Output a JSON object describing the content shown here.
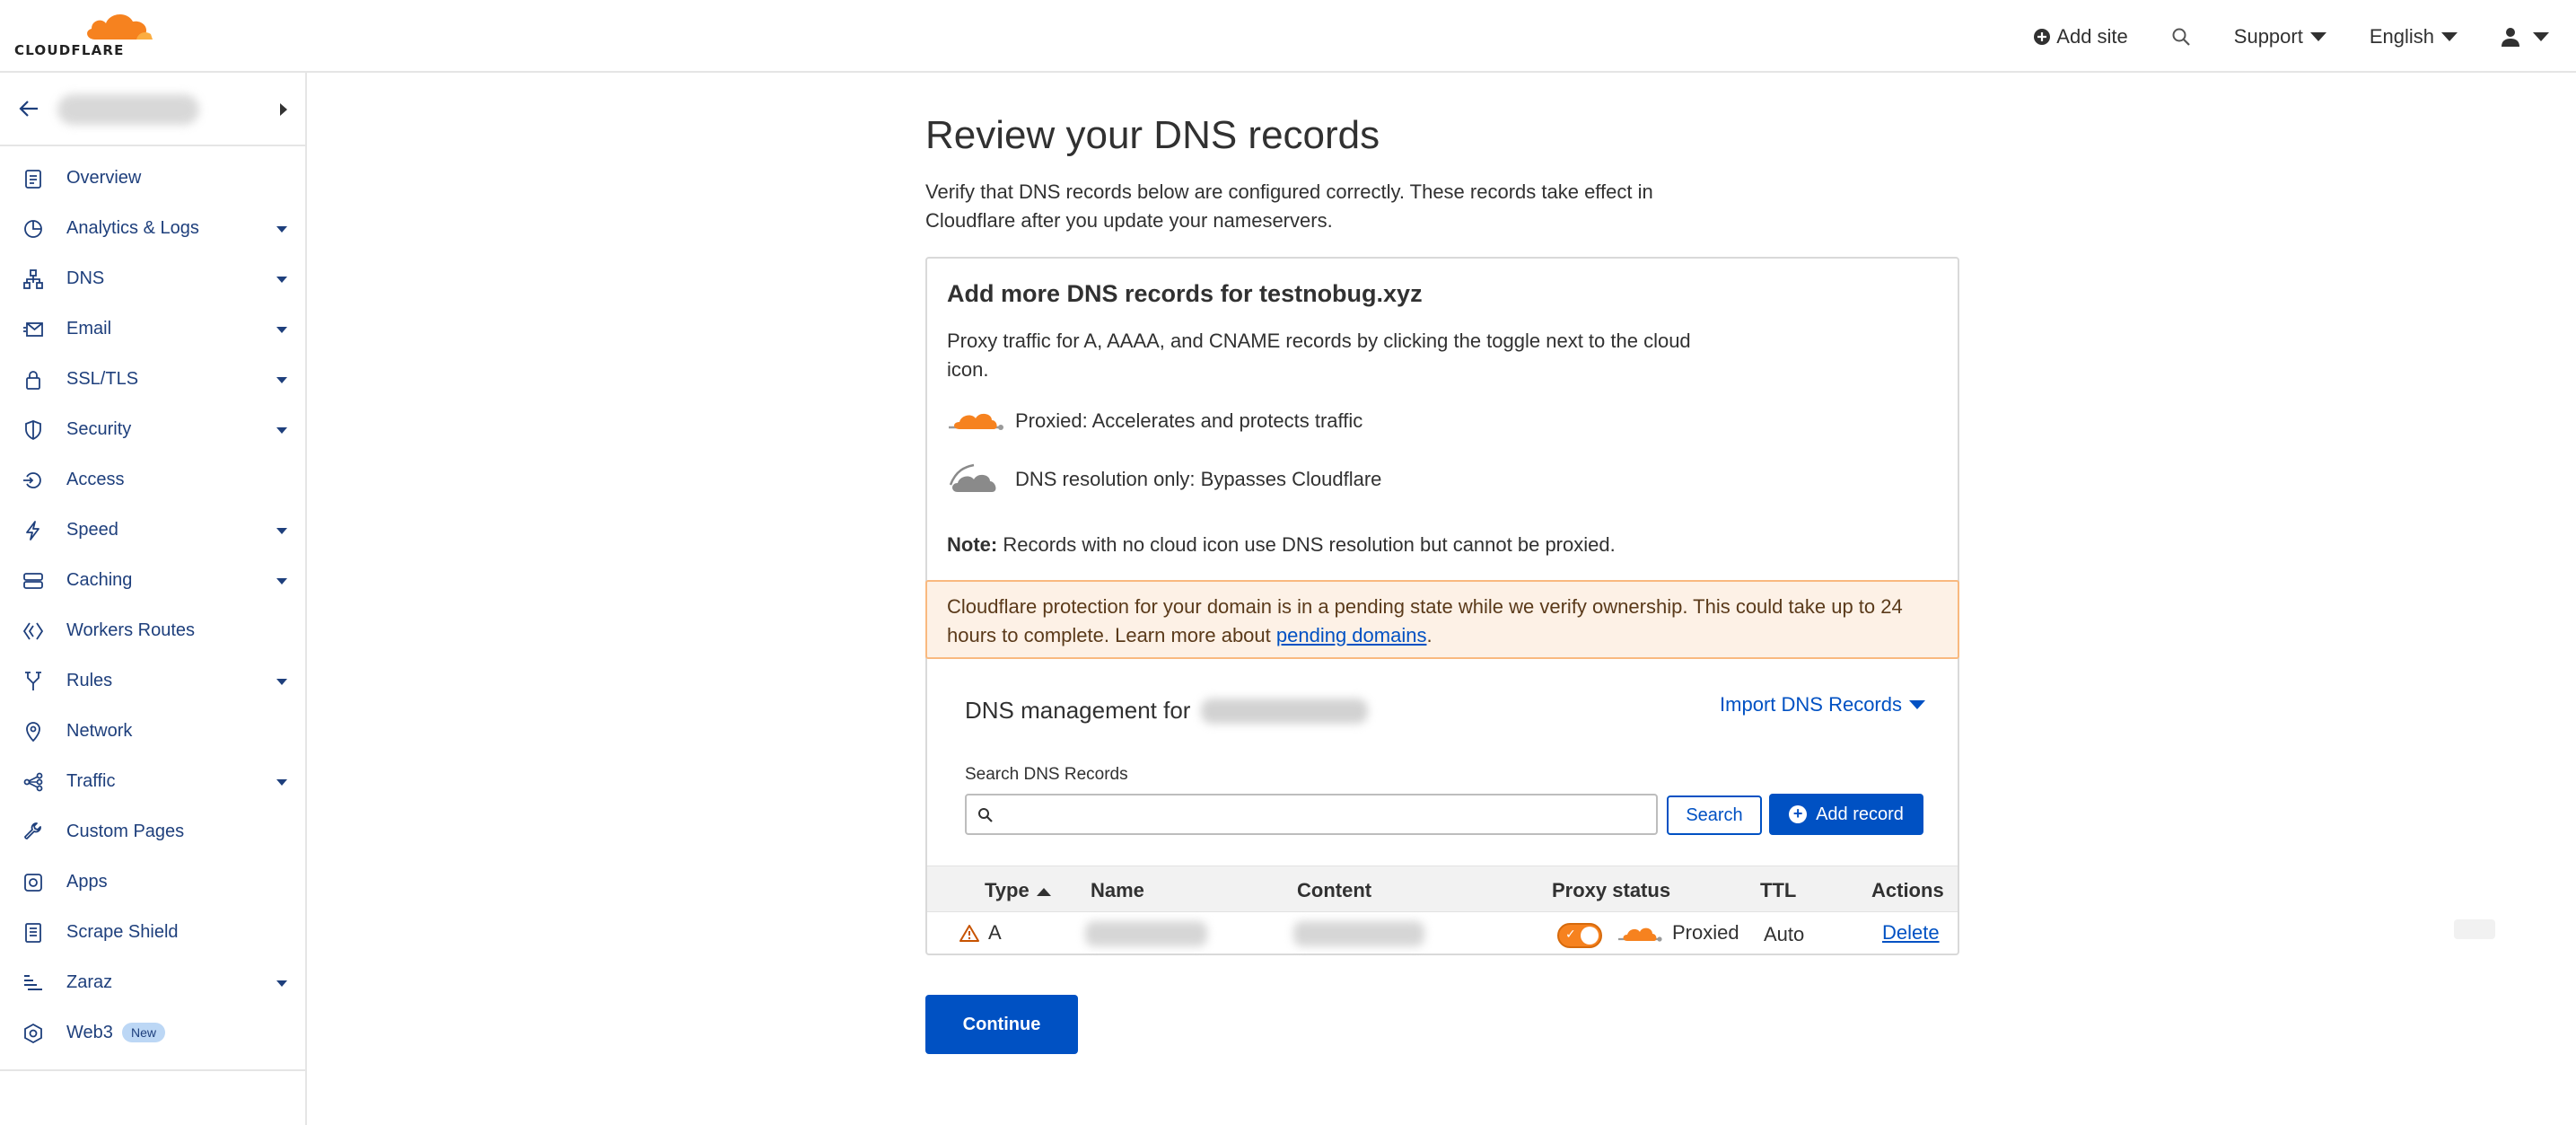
{
  "brand": {
    "name": "CLOUDFLARE",
    "orange": "#f6821f",
    "blue": "#0051c3"
  },
  "topnav": {
    "add_site": "Add site",
    "support": "Support",
    "language": "English"
  },
  "sidebar": {
    "items": [
      {
        "label": "Overview",
        "icon": "clipboard-icon",
        "dropdown": false
      },
      {
        "label": "Analytics & Logs",
        "icon": "pie-chart-icon",
        "dropdown": true
      },
      {
        "label": "DNS",
        "icon": "network-tree-icon",
        "dropdown": true
      },
      {
        "label": "Email",
        "icon": "email-icon",
        "dropdown": true
      },
      {
        "label": "SSL/TLS",
        "icon": "lock-icon",
        "dropdown": true
      },
      {
        "label": "Security",
        "icon": "shield-icon",
        "dropdown": true
      },
      {
        "label": "Access",
        "icon": "access-icon",
        "dropdown": false
      },
      {
        "label": "Speed",
        "icon": "lightning-icon",
        "dropdown": true
      },
      {
        "label": "Caching",
        "icon": "cache-stack-icon",
        "dropdown": true
      },
      {
        "label": "Workers Routes",
        "icon": "workers-icon",
        "dropdown": false
      },
      {
        "label": "Rules",
        "icon": "rules-fork-icon",
        "dropdown": true
      },
      {
        "label": "Network",
        "icon": "location-pin-icon",
        "dropdown": false
      },
      {
        "label": "Traffic",
        "icon": "traffic-icon",
        "dropdown": true
      },
      {
        "label": "Custom Pages",
        "icon": "wrench-icon",
        "dropdown": false
      },
      {
        "label": "Apps",
        "icon": "apps-icon",
        "dropdown": false
      },
      {
        "label": "Scrape Shield",
        "icon": "document-icon",
        "dropdown": false
      },
      {
        "label": "Zaraz",
        "icon": "zaraz-icon",
        "dropdown": true
      },
      {
        "label": "Web3",
        "icon": "web3-icon",
        "dropdown": false,
        "badge": "New"
      }
    ]
  },
  "main": {
    "title": "Review your DNS records",
    "description": "Verify that DNS records below are configured correctly. These records take effect in Cloudflare after you update your nameservers.",
    "card": {
      "title": "Add more DNS records for testnobug.xyz",
      "proxy_text": "Proxy traffic for A, AAAA, and CNAME records by clicking the toggle next to the cloud icon.",
      "legend_proxied": "Proxied: Accelerates and protects traffic",
      "legend_dns_only": "DNS resolution only: Bypasses Cloudflare",
      "note_label": "Note:",
      "note_text": " Records with no cloud icon use DNS resolution but cannot be proxied.",
      "warning_text": "Cloudflare protection for your domain is in a pending state while we verify ownership. This could take up to 24 hours to complete. Learn more about ",
      "warning_link": "pending domains",
      "warning_end": ".",
      "dns_management": "DNS management for",
      "import_label": "Import DNS Records",
      "search_label": "Search DNS Records",
      "search_value": "",
      "search_button": "Search",
      "add_record": "Add record",
      "columns": [
        "Type",
        "Name",
        "Content",
        "Proxy status",
        "TTL",
        "Actions"
      ],
      "rows": [
        {
          "type": "A",
          "proxy_status": "Proxied",
          "ttl": "Auto",
          "action": "Delete"
        }
      ]
    },
    "continue_label": "Continue"
  }
}
